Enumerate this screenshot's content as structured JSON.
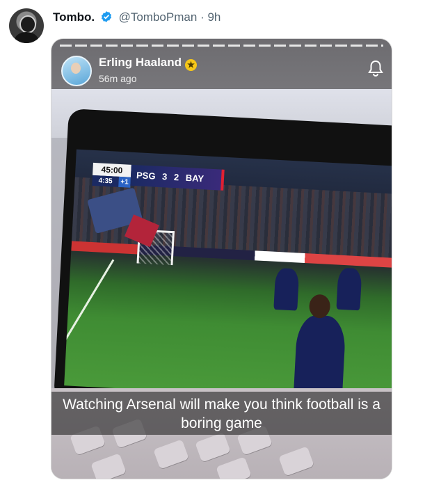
{
  "tweet": {
    "author_name": "Tombo.",
    "handle": "@TomboPman",
    "separator": "·",
    "time": "9h",
    "avatar_icon": "profile-avatar",
    "verified_icon": "verified-badge-icon",
    "verified_color": "#1d9bf0"
  },
  "snap": {
    "user_name": "Erling Haaland",
    "time_ago": "56m ago",
    "star_icon": "star-badge-icon",
    "star_color": "#f6c718",
    "bell_icon": "bell-icon",
    "caption": "Watching Arsenal will make you think football is a boring game"
  },
  "scoreboard": {
    "clock": "45:00",
    "added_time": "4:35",
    "plus": "+1",
    "home": "PSG",
    "home_score": "3",
    "away_score": "2",
    "away": "BAY"
  }
}
